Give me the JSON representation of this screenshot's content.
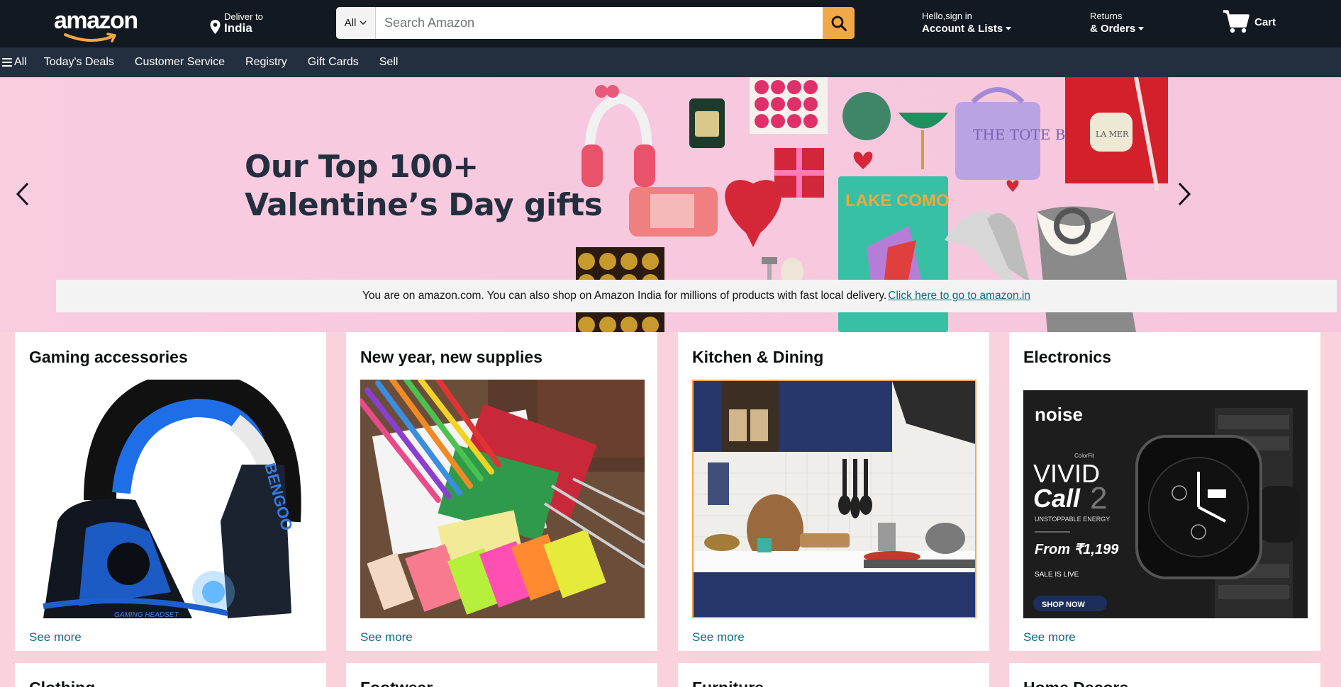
{
  "header": {
    "logo_text": "amazon",
    "deliver_line1": "Deliver to",
    "deliver_line2": "India",
    "search": {
      "category": "All",
      "placeholder": "Search Amazon"
    },
    "account_line1": "Hello,sign in",
    "account_line2": "Account & Lists",
    "orders_line1": "Returns",
    "orders_line2": "& Orders",
    "cart_label": "Cart"
  },
  "subnav": {
    "all_label": "All",
    "items": [
      "Today's Deals",
      "Customer Service",
      "Registry",
      "Gift Cards",
      "Sell"
    ]
  },
  "hero": {
    "title": "Our Top 100+\nValentine’s Day gifts"
  },
  "notice": {
    "text": "You are on amazon.com. You can also shop on Amazon India for millions of products with fast local delivery.",
    "link": " Click here to go to amazon.in"
  },
  "cards": [
    {
      "title": "Gaming accessories",
      "see_more": "See more",
      "image": "gaming-headset"
    },
    {
      "title": "New year, new supplies",
      "see_more": "See more",
      "image": "office-supplies"
    },
    {
      "title": "Kitchen & Dining",
      "see_more": "See more",
      "image": "kitchen"
    },
    {
      "title": "Electronics",
      "see_more": "See more",
      "image": "noise-smartwatch-ad"
    }
  ],
  "electronics_ad": {
    "brand": "noise",
    "subbrand": "ColorFit",
    "line1": "VIVID",
    "line2": "Call",
    "line2_suffix": "2",
    "tagline": "UNSTOPPABLE ENERGY",
    "price": "From ₹1,199",
    "sale": "SALE IS LIVE",
    "cta": "SHOP NOW"
  },
  "headset_print": {
    "brand": "BENGOO",
    "band": "GAMING HEADSET"
  },
  "hero_print": {
    "book_title": "LAKE COMO",
    "bag_label": "THE TOTE BAG",
    "jar_label": "LA MER"
  },
  "second_row": [
    "Clothing",
    "Footwear",
    "Furniture",
    "Home Decors"
  ],
  "colors": {
    "nav_dark": "#131921",
    "subnav": "#232f3e",
    "search_button": "#f3a847",
    "link": "#007185",
    "page_bg": "#f9d2dc"
  }
}
